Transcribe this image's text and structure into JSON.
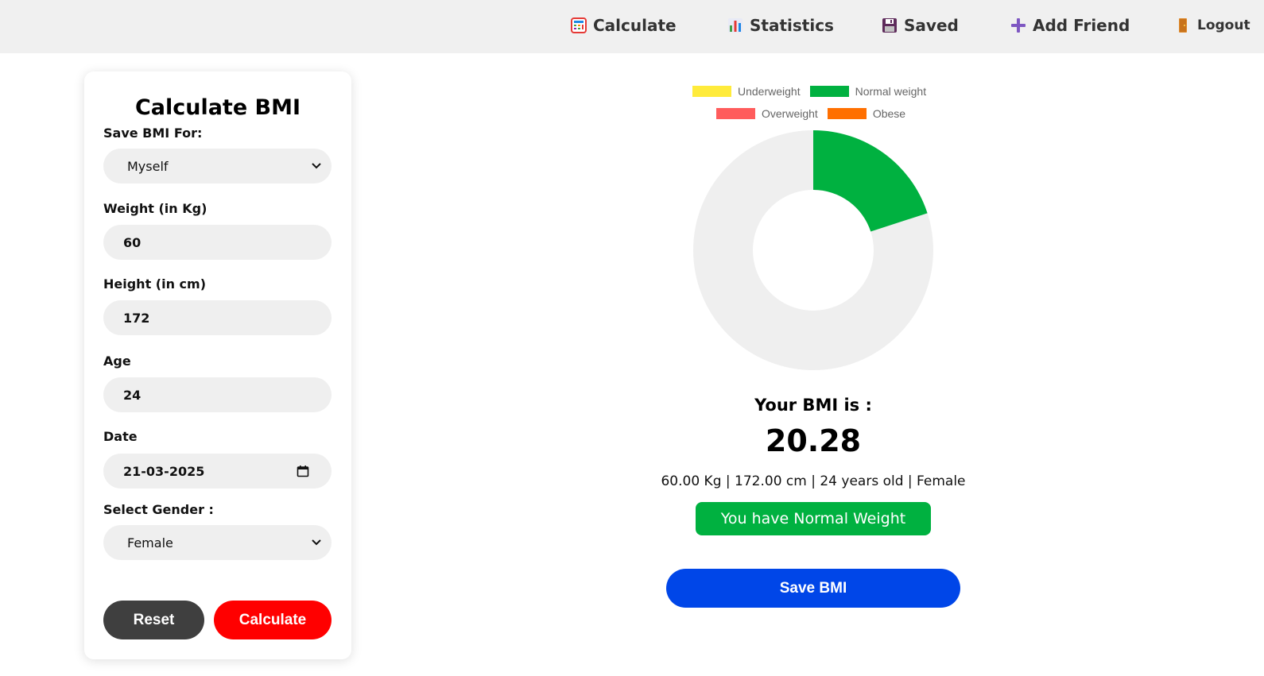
{
  "nav": {
    "items": [
      {
        "label": "Calculate",
        "icon": "calculator-icon"
      },
      {
        "label": "Statistics",
        "icon": "bar-chart-icon"
      },
      {
        "label": "Saved",
        "icon": "floppy-disk-icon"
      },
      {
        "label": "Add Friend",
        "icon": "plus-icon"
      },
      {
        "label": "Logout",
        "icon": "door-icon"
      }
    ]
  },
  "form": {
    "title": "Calculate BMI",
    "save_for_label": "Save BMI For:",
    "save_for_value": "Myself",
    "weight_label": "Weight (in Kg)",
    "weight_value": "60",
    "height_label": "Height (in cm)",
    "height_value": "172",
    "age_label": "Age",
    "age_value": "24",
    "date_label": "Date",
    "date_value": "21-03-2025",
    "gender_label": "Select Gender :",
    "gender_value": "Female",
    "reset_label": "Reset",
    "calculate_label": "Calculate"
  },
  "chart_data": {
    "type": "pie",
    "variant": "doughnut",
    "legend": [
      "Underweight",
      "Normal weight",
      "Overweight",
      "Obese"
    ],
    "legend_colors": [
      "#ffeb3b",
      "#00b140",
      "#ff5c5c",
      "#ff6f00"
    ],
    "legend_placement": "top",
    "filled_segment": {
      "label": "Normal weight",
      "fraction": 0.2,
      "color": "#00b140"
    },
    "remainder_color": "#efefef"
  },
  "result": {
    "heading": "Your BMI is :",
    "value": "20.28",
    "details": "60.00 Kg | 172.00 cm | 24 years old | Female",
    "status": "You have Normal Weight",
    "save_label": "Save BMI"
  },
  "colors": {
    "reset": "#3f3f3f",
    "calculate": "#ff0000",
    "status": "#00b140",
    "save": "#0046e8"
  }
}
